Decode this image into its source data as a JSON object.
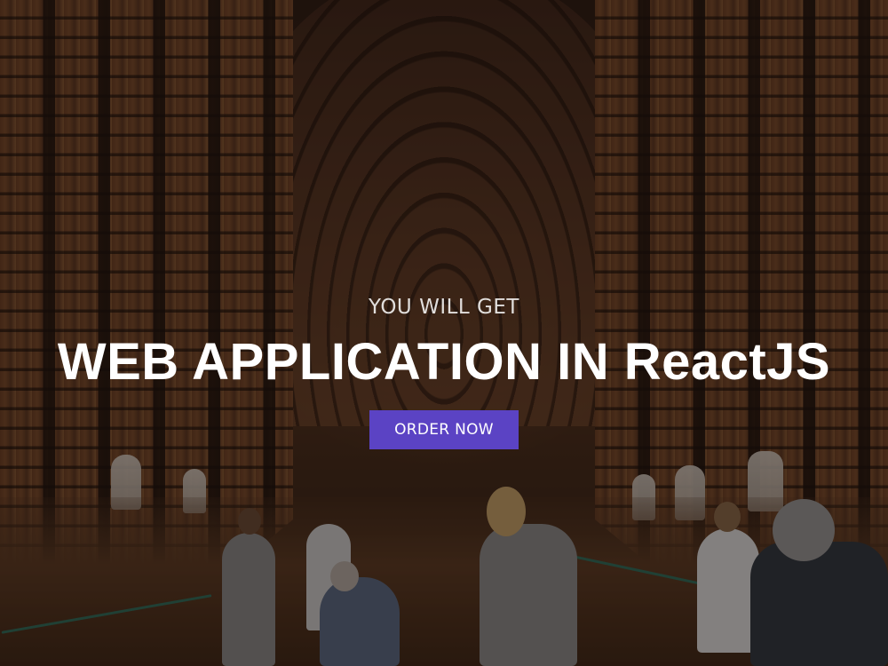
{
  "hero": {
    "kicker": "YOU WILL GET",
    "headline": "WEB APPLICATION IN ReactJS",
    "cta_label": "ORDER NOW"
  },
  "colors": {
    "cta_background": "#5b43c4",
    "text": "#ffffff"
  },
  "background_image": "library-hall-photo"
}
